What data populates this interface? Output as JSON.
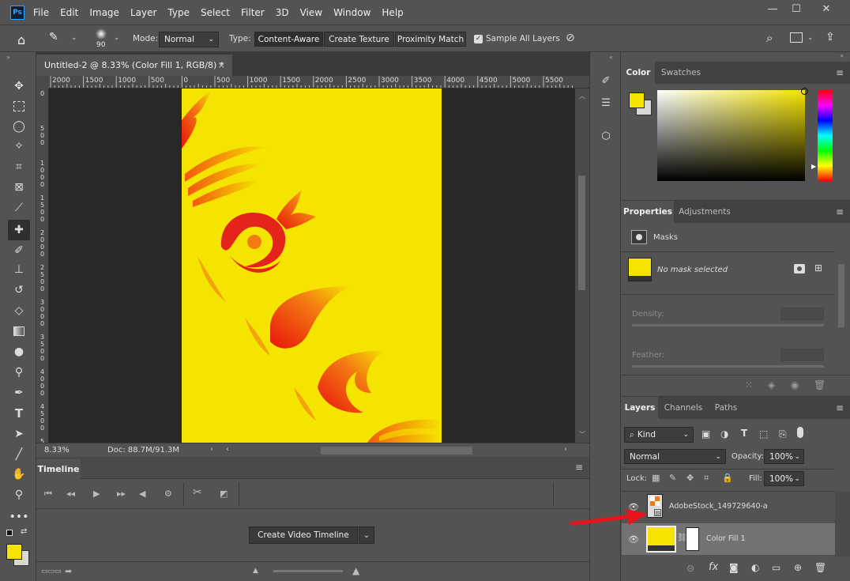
{
  "app": {
    "logo": "Ps"
  },
  "menu": [
    "File",
    "Edit",
    "Image",
    "Layer",
    "Type",
    "Select",
    "Filter",
    "3D",
    "View",
    "Window",
    "Help"
  ],
  "window_controls": {
    "minimize": "—",
    "maximize": "☐",
    "close": "✕"
  },
  "options": {
    "brush_size": "90",
    "mode_label": "Mode:",
    "mode_value": "Normal",
    "type_label": "Type:",
    "type_buttons": [
      "Content-Aware",
      "Create Texture",
      "Proximity Match"
    ],
    "sample_all_layers": "Sample All Layers"
  },
  "document": {
    "tab_title": "Untitled-2 @ 8.33% (Color Fill 1, RGB/8) *",
    "close": "×",
    "ruler_ticks": [
      "2000",
      "1500",
      "1000",
      "500",
      "0",
      "500",
      "1000",
      "1500",
      "2000",
      "2500",
      "3000",
      "3500",
      "4000",
      "4500",
      "5000",
      "5500"
    ],
    "vruler": [
      "0",
      "5\n0\n0",
      "1\n0\n0\n0",
      "1\n5\n0\n0",
      "2\n0\n0\n0",
      "2\n5\n0\n0",
      "3\n0\n0\n0",
      "3\n5\n0\n0",
      "4\n0\n0\n0",
      "4\n5\n0\n0",
      "5\n0\n0\n0"
    ],
    "canvas_color": "#f5e400"
  },
  "status": {
    "zoom": "8.33%",
    "doc": "Doc: 88.7M/91.3M"
  },
  "timeline": {
    "tab": "Timeline",
    "create_button": "Create Video Timeline"
  },
  "color_panel": {
    "tabs": [
      "Color",
      "Swatches"
    ],
    "foreground": "#f5e400"
  },
  "properties_panel": {
    "tabs": [
      "Properties",
      "Adjustments"
    ],
    "section": "Masks",
    "no_mask": "No mask selected",
    "density_label": "Density:",
    "feather_label": "Feather:"
  },
  "layers_panel": {
    "tabs": [
      "Layers",
      "Channels",
      "Paths"
    ],
    "kind": "Kind",
    "blend": "Normal",
    "opacity_label": "Opacity:",
    "opacity": "100%",
    "lock_label": "Lock:",
    "fill_label": "Fill:",
    "fill": "100%",
    "layers": [
      {
        "name": "AdobeStock_149729640-a"
      },
      {
        "name": "Color Fill 1"
      }
    ]
  },
  "annotation_color": "#e8141c"
}
